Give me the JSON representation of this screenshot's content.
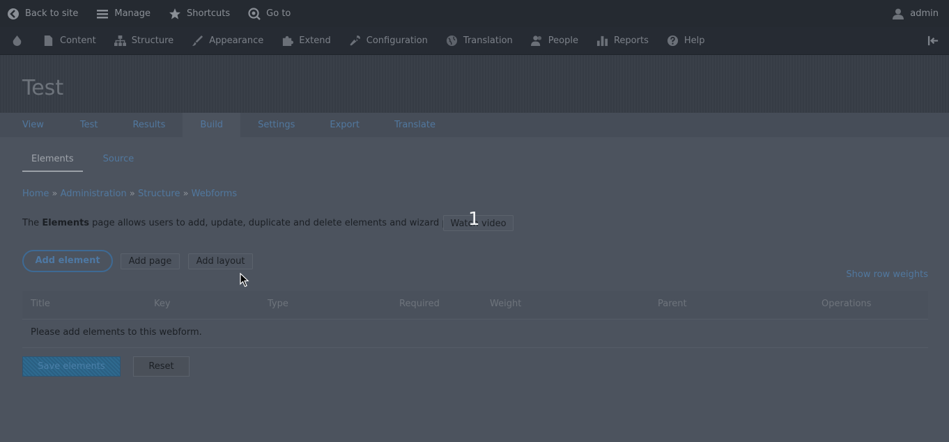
{
  "toolbar": {
    "back": "Back to site",
    "manage": "Manage",
    "shortcuts": "Shortcuts",
    "goto": "Go to",
    "user": "admin"
  },
  "tray": {
    "items": [
      "Content",
      "Structure",
      "Appearance",
      "Extend",
      "Configuration",
      "Translation",
      "People",
      "Reports",
      "Help"
    ]
  },
  "header": {
    "title": "Test"
  },
  "primary_tabs": [
    "View",
    "Test",
    "Results",
    "Build",
    "Settings",
    "Export",
    "Translate"
  ],
  "secondary_tabs": [
    "Elements",
    "Source"
  ],
  "breadcrumb": [
    "Home",
    "Administration",
    "Structure",
    "Webforms"
  ],
  "intro": {
    "prefix": "The ",
    "bold": "Elements",
    "suffix": " page allows users to add, update, duplicate and delete elements and wizard pages."
  },
  "buttons": {
    "watch_video": "Watch video",
    "add_element": "Add element",
    "add_page": "Add page",
    "add_layout": "Add layout",
    "show_weights": "Show row weights",
    "save": "Save elements",
    "reset": "Reset"
  },
  "overlay": {
    "number": "1"
  },
  "table": {
    "headers": [
      "Title",
      "Key",
      "Type",
      "Required",
      "Weight",
      "Parent",
      "Operations"
    ],
    "empty": "Please add elements to this webform."
  }
}
